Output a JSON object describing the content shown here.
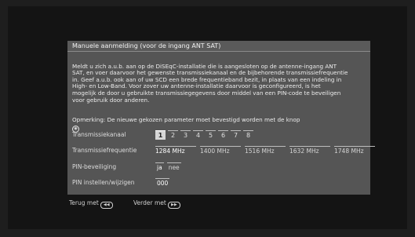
{
  "dialog": {
    "title": "Manuele aanmelding (voor de ingang ANT SAT)",
    "body": "Meldt u zich a.u.b. aan op de DiSEqC-installatie die is aangesloten op de antenne-ingang ANT\nSAT, en voer daarvoor het gewenste transmissiekanaal en de bijbehorende transmissiefrequentie\nin. Geef a.u.b. ook aan of uw SCD een brede frequentieband bezit, in plaats van een indeling in\nHigh- en Low-Band. Voor zover uw antenne-installatie daarvoor is geconfigureerd, is het\nmogelijk de door u gebruikte transmissiegegevens door middel van een PIN-code te beveiligen\nvoor gebruik door anderen.",
    "note": "Opmerking: De nieuwe gekozen parameter moet bevestigd worden met de knop",
    "note_icon": "ok-icon"
  },
  "fields": {
    "channel_label": "Transmissiekanaal",
    "channels": [
      "1",
      "2",
      "3",
      "4",
      "5",
      "6",
      "7",
      "8"
    ],
    "channel_selected": "1",
    "freq_label": "Transmissiefrequentie",
    "frequencies": [
      "1284 MHz",
      "1400 MHz",
      "1516 MHz",
      "1632 MHz",
      "1748 MHz"
    ],
    "pin_label": "PIN-beveiliging",
    "pin_options": [
      "ja",
      "nee"
    ],
    "pin_change_label": "PIN instellen/wijzigen",
    "pin_code": "000"
  },
  "footer": {
    "back_label": "Terug met",
    "next_label": "Verder met"
  }
}
